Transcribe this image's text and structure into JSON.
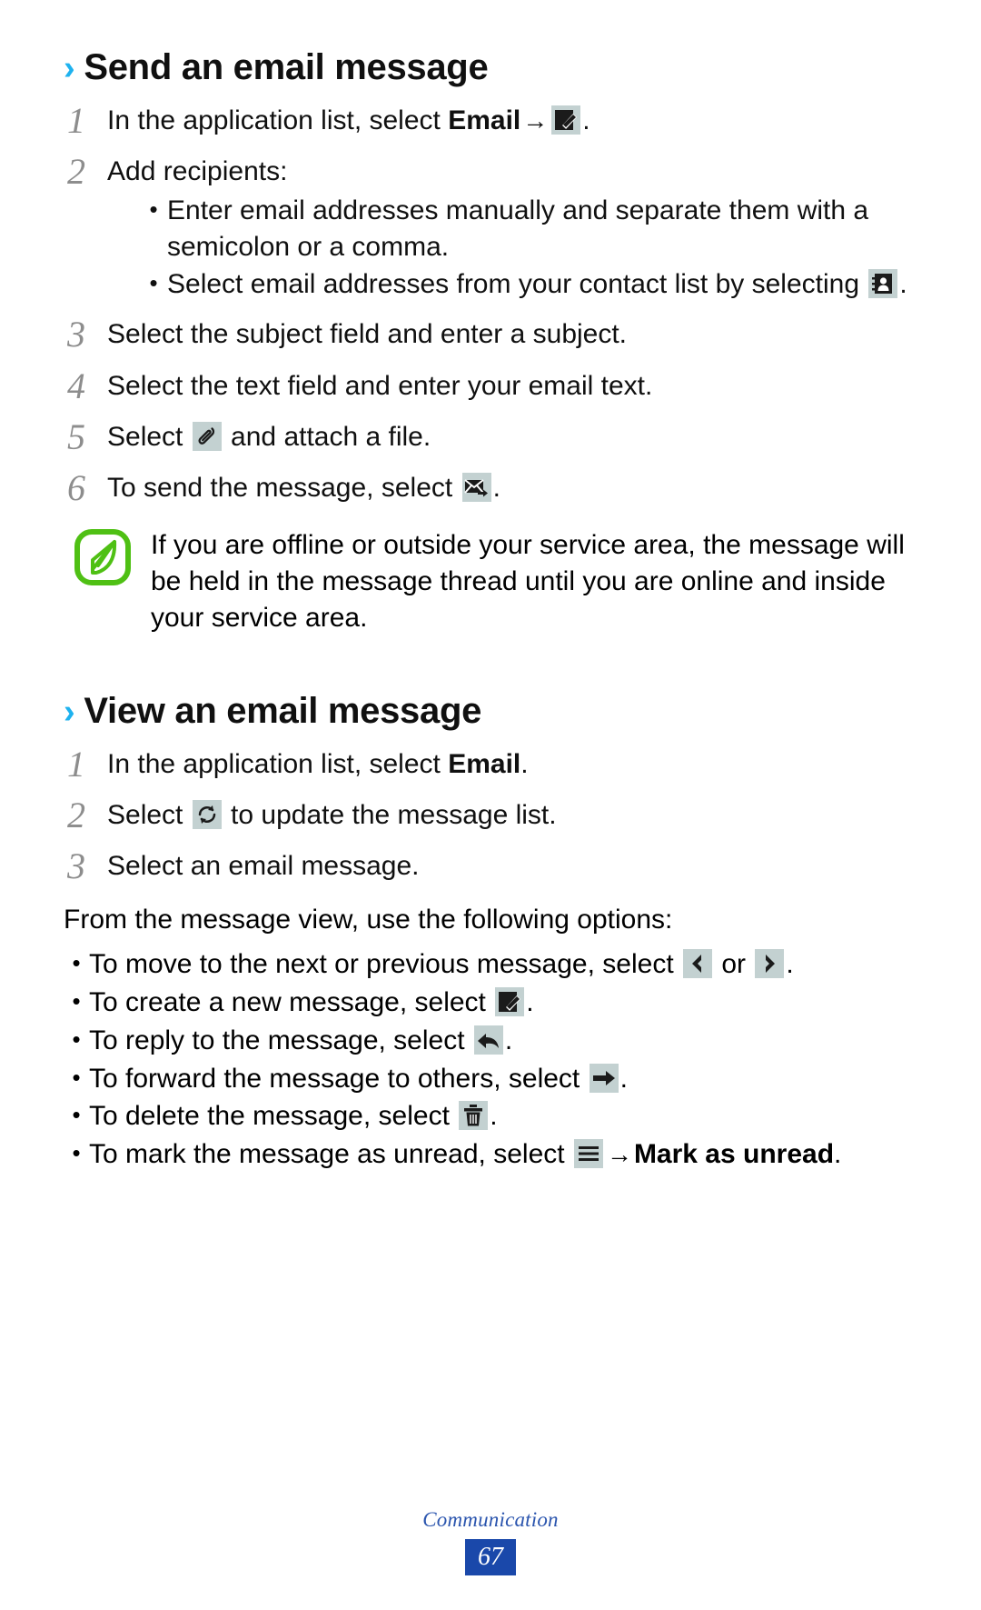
{
  "sections": [
    {
      "id": "send",
      "heading": "Send an email message",
      "chevron": "›",
      "steps": [
        {
          "number": "1",
          "pre": "In the application list, select ",
          "bold": "Email",
          "arrow": "→",
          "icon": "compose-icon",
          "post": "."
        },
        {
          "number": "2",
          "pre": "Add recipients:",
          "sub_bullets": [
            {
              "text": "Enter email addresses manually and separate them with a semicolon or a comma."
            },
            {
              "text_pre": "Select email addresses from your contact list by selecting ",
              "icon": "contacts-icon",
              "text_post": "."
            }
          ]
        },
        {
          "number": "3",
          "pre": "Select the subject field and enter a subject."
        },
        {
          "number": "4",
          "pre": "Select the text field and enter your email text."
        },
        {
          "number": "5",
          "pre": "Select ",
          "icon": "attachment-icon",
          "post": " and attach a file."
        },
        {
          "number": "6",
          "pre": "To send the message, select ",
          "icon": "send-icon",
          "post": "."
        }
      ],
      "note": {
        "icon": "note-leaf-icon",
        "text": "If you are offline or outside your service area, the message will be held in the message thread until you are online and inside your service area."
      }
    },
    {
      "id": "view",
      "heading": "View an email message",
      "chevron": "›",
      "steps": [
        {
          "number": "1",
          "pre": "In the application list, select ",
          "bold": "Email",
          "post": "."
        },
        {
          "number": "2",
          "pre": "Select ",
          "icon": "refresh-icon",
          "post": " to update the message list."
        },
        {
          "number": "3",
          "pre": "Select an email message."
        }
      ],
      "intro": "From the message view, use the following options:",
      "options": [
        {
          "text_pre": "To move to the next or previous message, select ",
          "icon": "previous-icon",
          "mid": " or ",
          "icon2": "next-icon",
          "text_post": "."
        },
        {
          "text_pre": "To create a new message, select ",
          "icon": "compose-icon",
          "text_post": "."
        },
        {
          "text_pre": "To reply to the message, select ",
          "icon": "reply-icon",
          "text_post": "."
        },
        {
          "text_pre": "To forward the message to others, select ",
          "icon": "forward-icon",
          "text_post": "."
        },
        {
          "text_pre": "To delete the message, select ",
          "icon": "delete-icon",
          "text_post": "."
        },
        {
          "text_pre": "To mark the message as unread, select ",
          "icon": "menu-icon",
          "arrow": "→",
          "bold": "Mark as unread",
          "text_post": "."
        }
      ]
    }
  ],
  "footer": {
    "label": "Communication",
    "page_number": "67"
  },
  "colors": {
    "chevron_blue": "#1eb2ef",
    "footer_blue": "#2b55ae",
    "page_badge": "#1a48aa",
    "icon_chip_bg": "#c3d1d1",
    "note_green": "#4fc014",
    "step_number_gray": "#8d8d8d"
  }
}
